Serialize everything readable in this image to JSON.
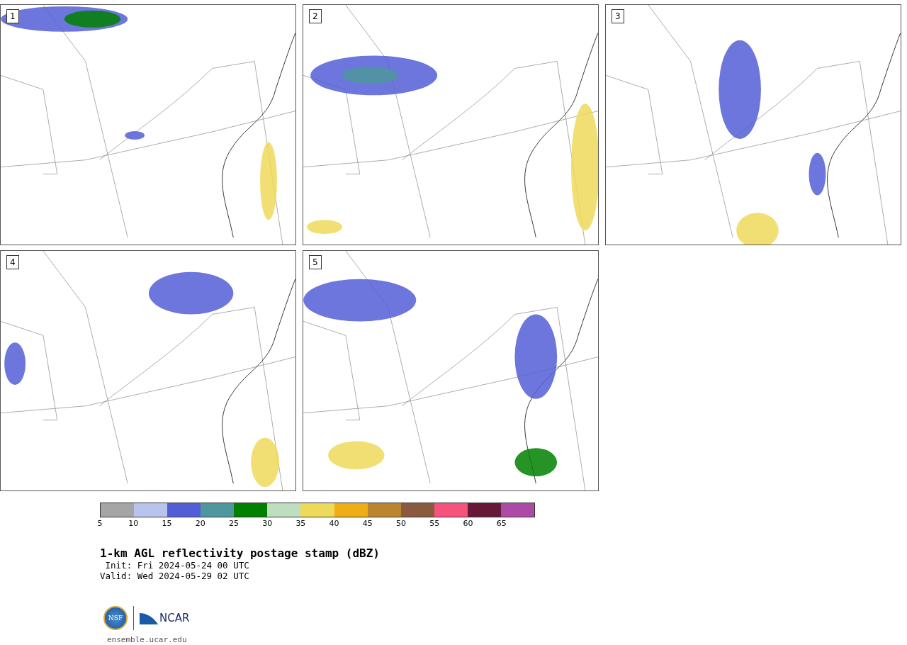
{
  "panels": [
    {
      "label": "1"
    },
    {
      "label": "2"
    },
    {
      "label": "3"
    },
    {
      "label": "4"
    },
    {
      "label": "5"
    }
  ],
  "colorbar": {
    "bins": [
      {
        "color": "#a5a5a5"
      },
      {
        "color": "#b9c4ed"
      },
      {
        "color": "#525ed6"
      },
      {
        "color": "#4f979e"
      },
      {
        "color": "#008000"
      },
      {
        "color": "#bfdebf"
      },
      {
        "color": "#eed95a"
      },
      {
        "color": "#efae14"
      },
      {
        "color": "#bb842f"
      },
      {
        "color": "#8a5a3e"
      },
      {
        "color": "#f5527c"
      },
      {
        "color": "#651837"
      },
      {
        "color": "#ac4ba6"
      }
    ],
    "ticks": [
      "5",
      "10",
      "15",
      "20",
      "25",
      "30",
      "35",
      "40",
      "45",
      "50",
      "55",
      "60",
      "65"
    ]
  },
  "title": "1-km AGL reflectivity postage stamp (dBZ)",
  "init": " Init: Fri 2024-05-24 00 UTC",
  "valid": "Valid: Wed 2024-05-29 02 UTC",
  "logo": {
    "left": "NSF",
    "right": "NCAR"
  },
  "footer": "ensemble.ucar.edu"
}
